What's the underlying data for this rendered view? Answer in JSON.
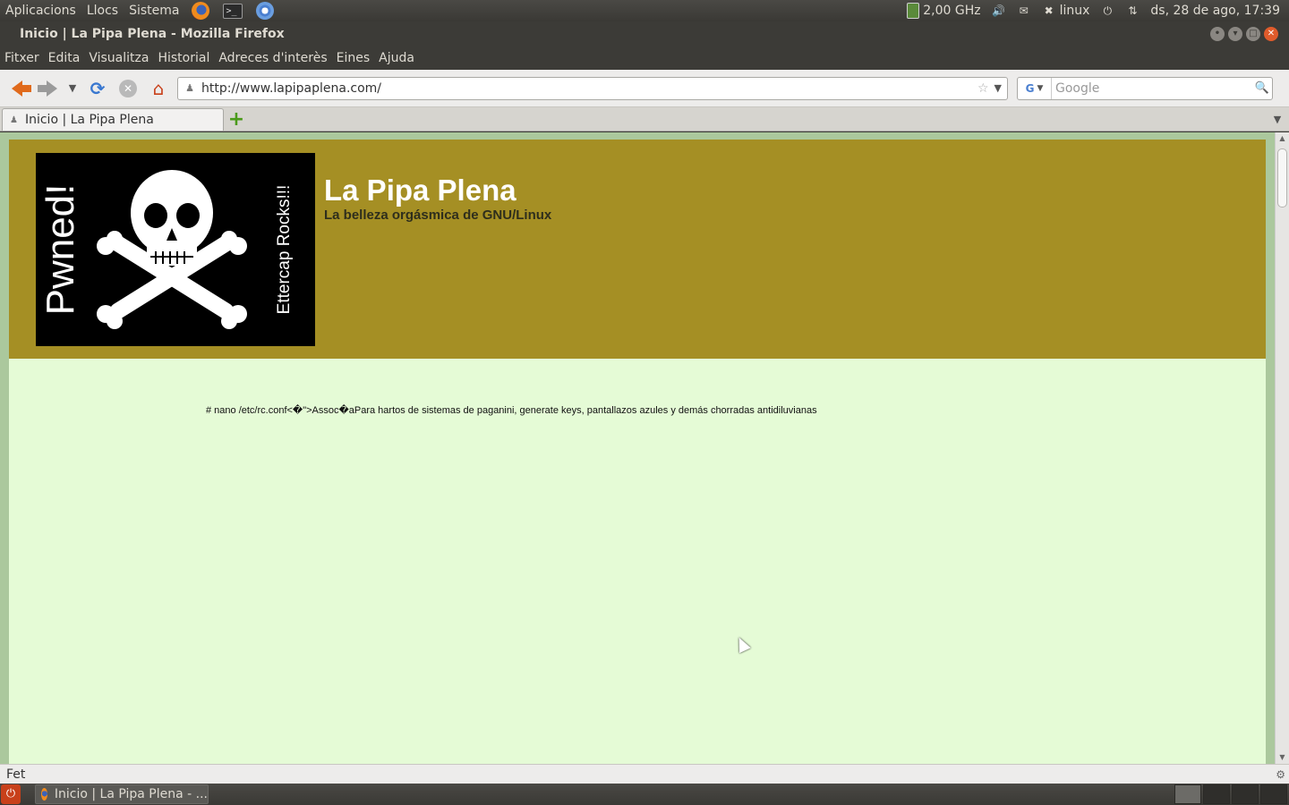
{
  "top_panel": {
    "menus": [
      "Aplicacions",
      "Llocs",
      "Sistema"
    ],
    "launchers": [
      "firefox-icon",
      "terminal-icon",
      "chromium-icon"
    ],
    "terminal_glyph": ">_",
    "cpu_freq": "2,00 GHz",
    "user": "linux",
    "clock": "ds, 28 de ago, 17:39"
  },
  "window": {
    "title": "Inicio | La Pipa Plena - Mozilla Firefox"
  },
  "menubar": {
    "items": [
      "Fitxer",
      "Edita",
      "Visualitza",
      "Historial",
      "Adreces d'interès",
      "Eines",
      "Ajuda"
    ]
  },
  "navbar": {
    "url": "http://www.lapipaplena.com/",
    "search_placeholder": "Google",
    "search_engine": "G"
  },
  "tabs": [
    {
      "label": "Inicio | La Pipa Plena"
    }
  ],
  "page": {
    "logo_left_text": "Pwned!",
    "logo_right_text": "Ettercap Rocks!!!",
    "site_title": "La Pipa Plena",
    "site_tagline": "La belleza orgásmica de GNU/Linux",
    "body_text": "# nano /etc/rc.conf<�\">Assoc�aPara hartos de sistemas de paganini, generate keys, pantallazos azules y demás chorradas antidiluvianas"
  },
  "colors": {
    "header_bg": "#a58f24",
    "page_bg": "#e5fbd6",
    "frame_bg": "#abc89d"
  },
  "statusbar": {
    "text": "Fet"
  },
  "bottom_panel": {
    "task_label": "Inicio | La Pipa Plena - ..."
  }
}
